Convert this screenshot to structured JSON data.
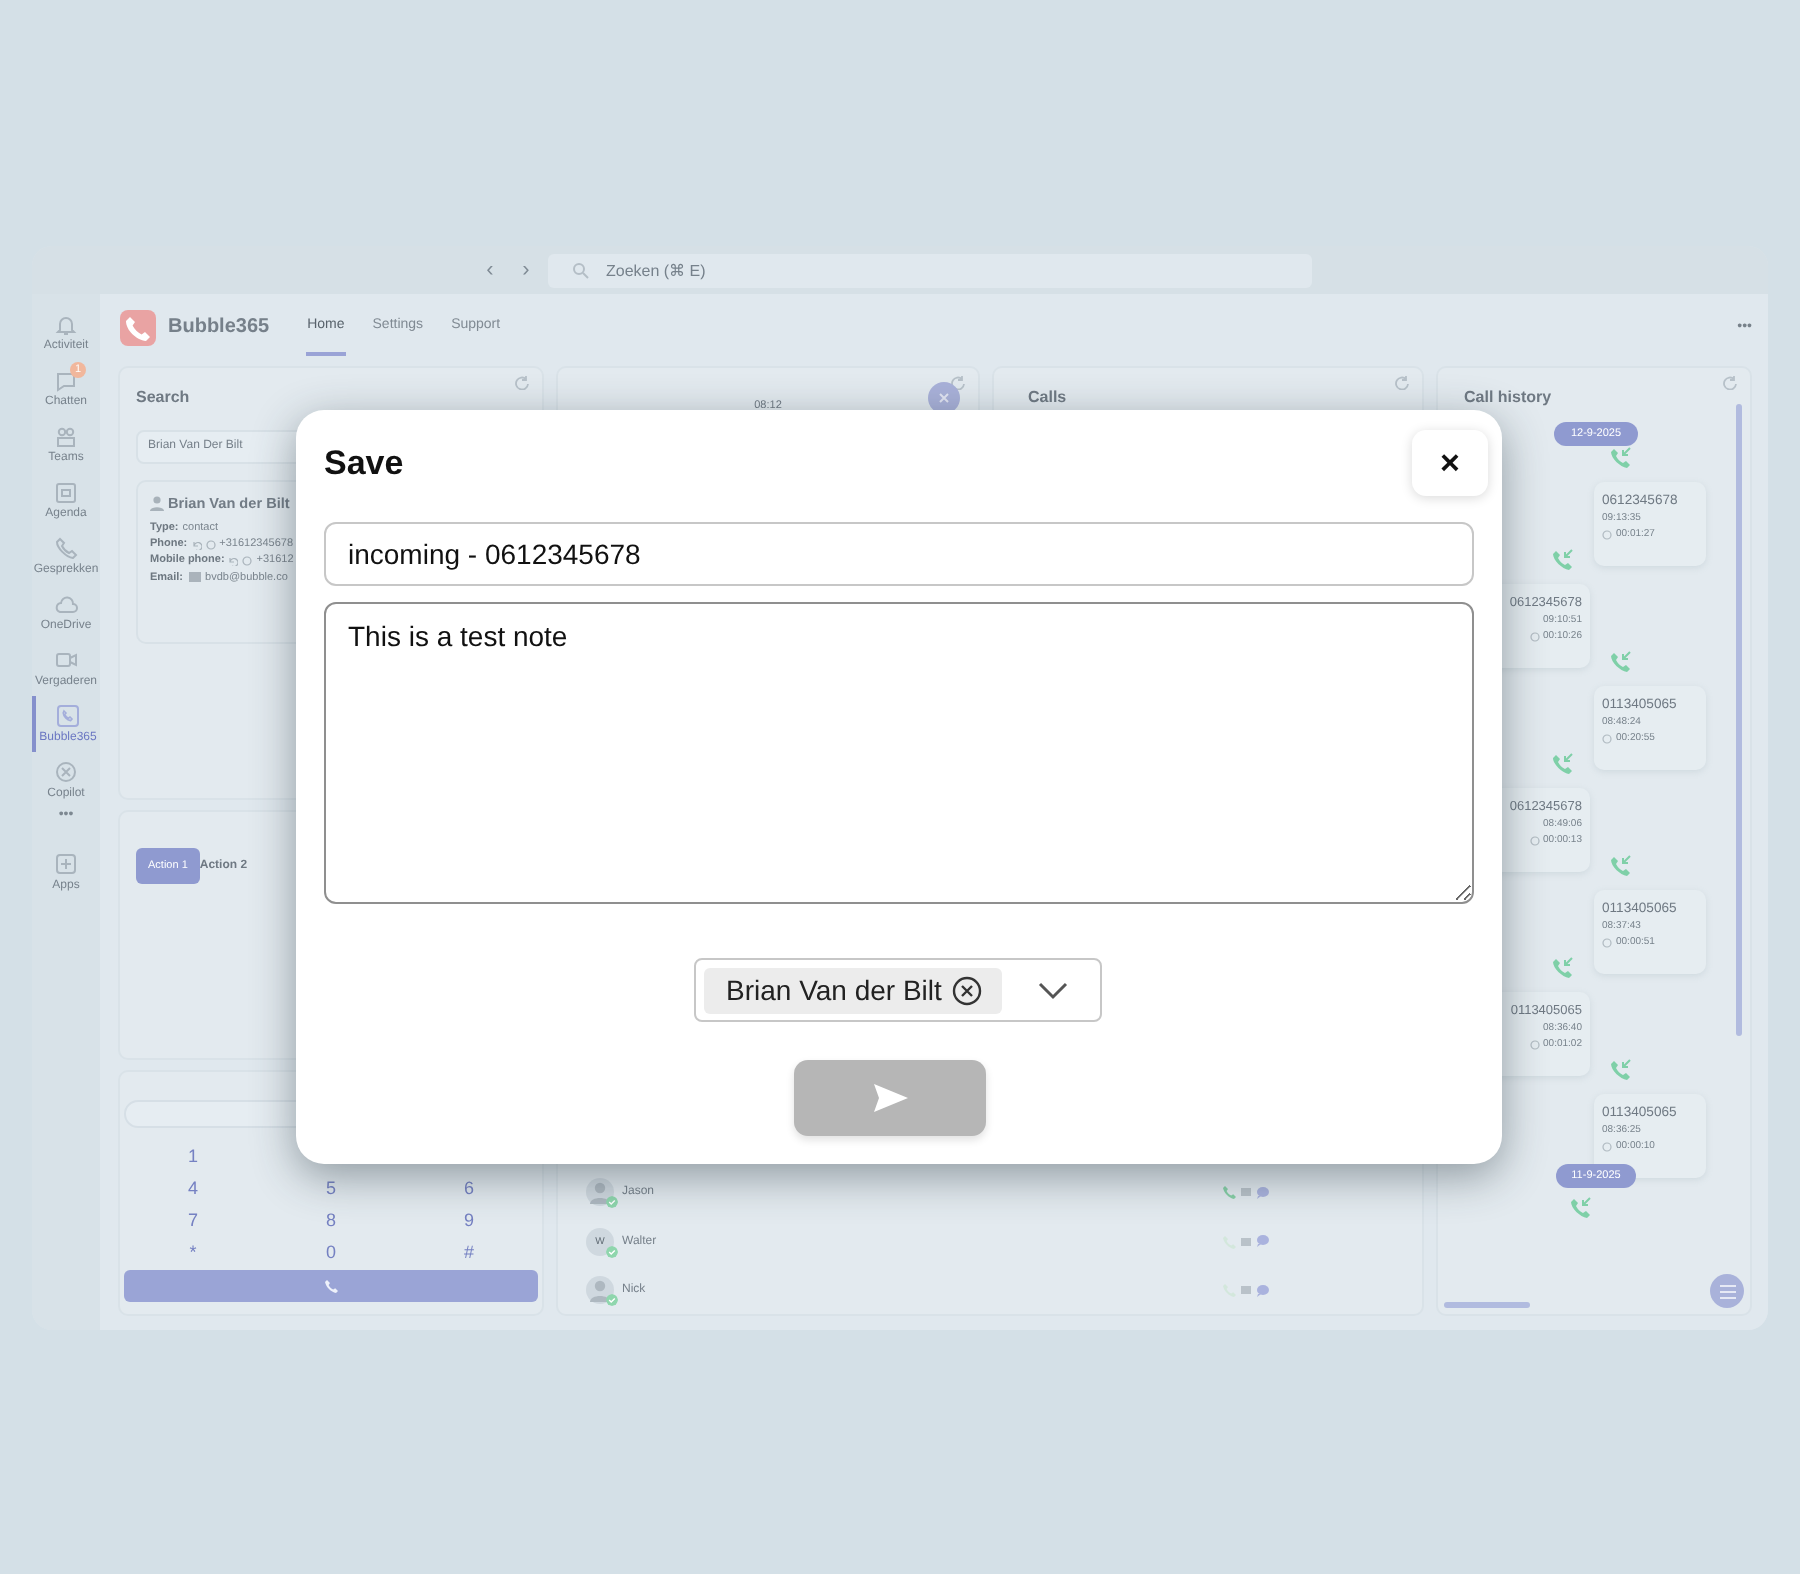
{
  "top_bar": {
    "nav": [
      "‹",
      "›"
    ],
    "search_placeholder": "Zoeken (⌘ E)"
  },
  "rail": [
    {
      "label": "Activiteit",
      "kind": "bell",
      "selected": false
    },
    {
      "label": "Chatten",
      "kind": "chat",
      "badge": "1",
      "selected": false
    },
    {
      "label": "Teams",
      "kind": "teams",
      "selected": false
    },
    {
      "label": "Agenda",
      "kind": "calendar",
      "selected": false
    },
    {
      "label": "Gesprekken",
      "kind": "phone",
      "selected": false
    },
    {
      "label": "OneDrive",
      "kind": "cloud",
      "selected": false
    },
    {
      "label": "Vergaderen",
      "kind": "video",
      "selected": false
    },
    {
      "label": "Bubble365",
      "kind": "app",
      "selected": true
    },
    {
      "label": "Copilot",
      "kind": "copilot",
      "selected": false
    },
    {
      "label": "•••",
      "kind": "more"
    },
    {
      "label": "Apps",
      "kind": "plus",
      "selected": false
    }
  ],
  "app": {
    "name": "Bubble365",
    "more": "•••",
    "tabs": [
      {
        "label": "Home",
        "selected": true
      },
      {
        "label": "Settings",
        "selected": false
      },
      {
        "label": "Support",
        "selected": false
      }
    ]
  },
  "search_panel": {
    "title": "Search",
    "query": "Brian Van Der Bilt",
    "contact": {
      "name": "Brian Van der Bilt",
      "fields": [
        {
          "label": "Type:",
          "value": "contact",
          "kind": "text"
        },
        {
          "label": "Phone:",
          "value": "+31612345678",
          "kind": "phone"
        },
        {
          "label": "Mobile phone:",
          "value": "+31612",
          "kind": "phone"
        },
        {
          "label": "Email:",
          "value": "bvdb@bubble.co",
          "kind": "email"
        }
      ]
    }
  },
  "actions": [
    {
      "label": "Action 1",
      "kind": "button"
    },
    {
      "label": "Action 2",
      "kind": "text"
    }
  ],
  "dialpad": {
    "rows": [
      [
        "1"
      ],
      [
        "4",
        "5",
        "6"
      ],
      [
        "7",
        "8",
        "9"
      ],
      [
        "*",
        "0",
        "#"
      ]
    ]
  },
  "call_panel": {
    "time": "08:12"
  },
  "calls_panel": {
    "title": "Calls"
  },
  "contacts": [
    {
      "name": "Jason",
      "kind": "photo",
      "online": true,
      "phone_active": true
    },
    {
      "name": "Walter",
      "kind": "initial",
      "initial": "W",
      "online": true,
      "phone_active": false
    },
    {
      "name": "Nick",
      "kind": "photo",
      "online": true,
      "phone_active": false
    }
  ],
  "call_history": {
    "title": "Call history",
    "groups": [
      {
        "date": "12-9-2025",
        "calls": [
          {
            "kind": "right",
            "number": "0612345678",
            "time": "09:13:35",
            "duration": "00:01:27"
          },
          {
            "kind": "left",
            "number": "0612345678",
            "time": "09:10:51",
            "duration": "00:10:26"
          },
          {
            "kind": "right",
            "number": "0113405065",
            "time": "08:48:24",
            "duration": "00:20:55"
          },
          {
            "kind": "left",
            "number": "0612345678",
            "time": "08:49:06",
            "duration": "00:00:13"
          },
          {
            "kind": "right",
            "number": "0113405065",
            "time": "08:37:43",
            "duration": "00:00:51"
          },
          {
            "kind": "left",
            "number": "0113405065",
            "time": "08:36:40",
            "duration": "00:01:02"
          },
          {
            "kind": "right",
            "number": "0113405065",
            "time": "08:36:25",
            "duration": "00:00:10"
          }
        ]
      },
      {
        "date": "11-9-2025"
      }
    ]
  },
  "dialog": {
    "title": "Save",
    "close": "×",
    "subject": "incoming - 0612345678",
    "note": "This is a test note",
    "contact_chip": "Brian Van der Bilt",
    "send_disabled": true
  }
}
